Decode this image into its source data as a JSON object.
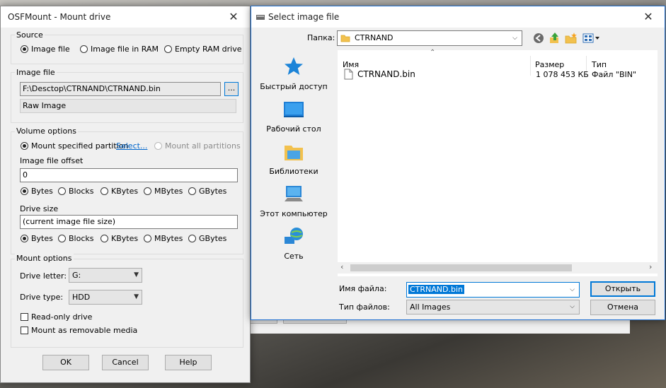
{
  "osf": {
    "title": "OSFMount - Mount drive",
    "source": {
      "label": "Source",
      "options": [
        "Image file",
        "Image file in RAM",
        "Empty RAM drive"
      ]
    },
    "image_file": {
      "label": "Image file",
      "path": "F:\\Desctop\\CTRNAND\\CTRNAND.bin",
      "browse": "...",
      "type": "Raw Image"
    },
    "volume": {
      "label": "Volume options",
      "mount_specified": "Mount specified partition",
      "select_link": "Select...",
      "mount_all": "Mount all partitions",
      "offset_label": "Image file offset",
      "offset_value": "0",
      "units": [
        "Bytes",
        "Blocks",
        "KBytes",
        "MBytes",
        "GBytes"
      ],
      "size_label": "Drive size",
      "size_value": "(current image file size)"
    },
    "mount": {
      "label": "Mount options",
      "drive_letter_label": "Drive letter:",
      "drive_letter": "G:",
      "drive_type_label": "Drive type:",
      "drive_type": "HDD",
      "readonly": "Read-only drive",
      "removable": "Mount as removable media"
    },
    "buttons": {
      "ok": "OK",
      "cancel": "Cancel",
      "help": "Help"
    }
  },
  "dialog": {
    "title": "Select image file",
    "folder_label": "Папка:",
    "folder_value": "CTRNAND",
    "places": [
      "Быстрый доступ",
      "Рабочий стол",
      "Библиотеки",
      "Этот компьютер",
      "Сеть"
    ],
    "columns": {
      "name": "Имя",
      "size": "Размер",
      "type": "Тип"
    },
    "files": [
      {
        "name": "CTRNAND.bin",
        "size": "1 078 453 КБ",
        "type": "Файл \"BIN\""
      }
    ],
    "filename_label": "Имя файла:",
    "filename_value": "CTRNAND.bin",
    "filetype_label": "Тип файлов:",
    "filetype_value": "All Images",
    "open": "Открыть",
    "cancel": "Отмена"
  },
  "colors": {
    "accent": "#0078d7",
    "link": "#0066cc"
  },
  "icons": [
    "close-icon",
    "folder-icon",
    "back-icon",
    "up-folder-icon",
    "new-folder-icon",
    "view-menu-icon",
    "star-icon",
    "desktop-icon",
    "libraries-icon",
    "computer-icon",
    "network-icon",
    "file-icon"
  ]
}
